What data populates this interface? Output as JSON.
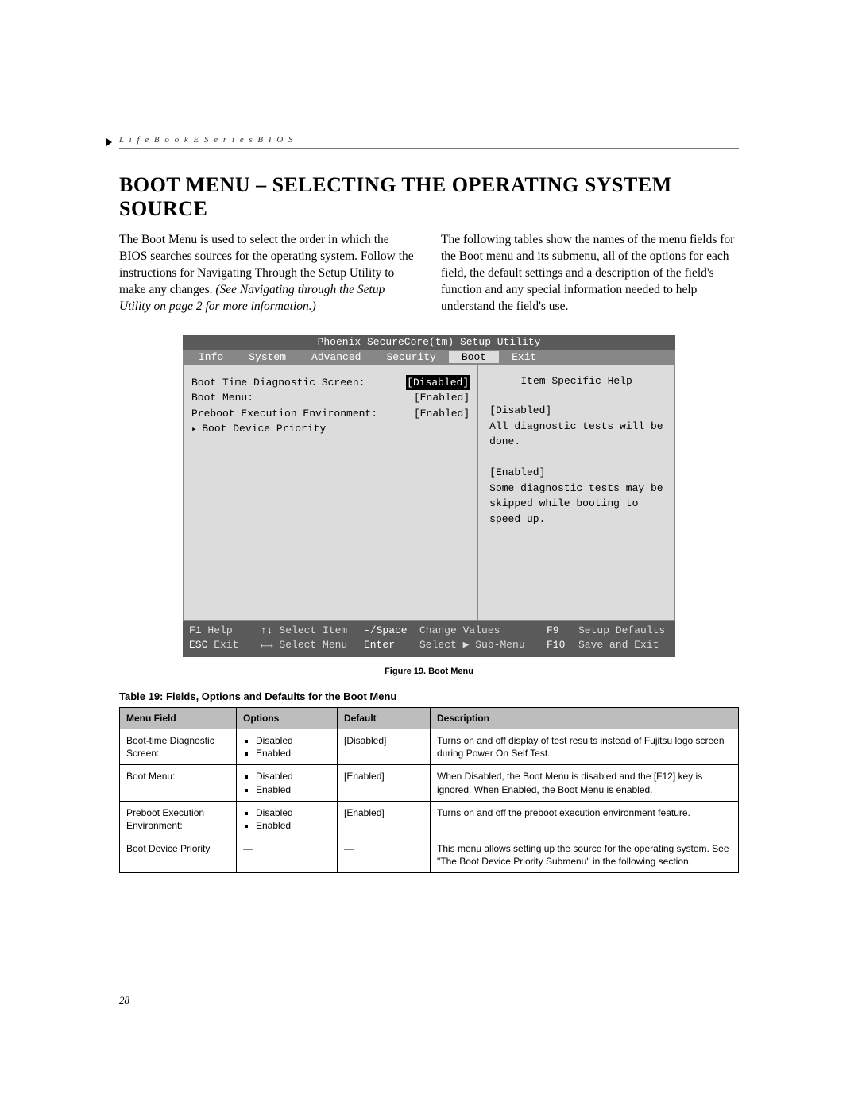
{
  "header_running": "L i f e B o o k   E   S e r i e s   B I O S",
  "title": "BOOT MENU – SELECTING THE OPERATING SYSTEM SOURCE",
  "para_left_plain": "The Boot Menu is used to select the order in which the BIOS searches sources for the operating system. Follow the instructions for Navigating Through the Setup Utility to make any changes. ",
  "para_left_italic": "(See Navigating through the Setup Utility on page 2 for more information.)",
  "para_right": "The following tables show the names of the menu fields for the Boot menu and its submenu, all of the options for each field, the default settings and a description of the field's function and any special information needed to help understand the field's use.",
  "bios": {
    "title": "Phoenix SecureCore(tm) Setup Utility",
    "tabs": [
      "Info",
      "System",
      "Advanced",
      "Security",
      "Boot",
      "Exit"
    ],
    "active_tab": "Boot",
    "items": [
      {
        "label": "Boot Time Diagnostic Screen:",
        "value": "[Disabled]",
        "selected": true
      },
      {
        "label": "Boot Menu:",
        "value": "[Enabled]",
        "selected": false
      },
      {
        "label": "Preboot Execution Environment:",
        "value": "[Enabled]",
        "selected": false
      }
    ],
    "submenu_label": "Boot Device Priority",
    "help": {
      "header": "Item Specific Help",
      "p1": "[Disabled]",
      "p2": "All diagnostic tests will be done.",
      "p3": "[Enabled]",
      "p4": "Some diagnostic tests may be skipped while booting to speed up."
    },
    "footer": {
      "r1": {
        "k1": "F1",
        "v1": "Help",
        "k2": "↑↓",
        "v2": "Select Item",
        "k3": "-/Space",
        "v3": "Change Values",
        "k4": "F9",
        "v4": "Setup Defaults"
      },
      "r2": {
        "k1": "ESC",
        "v1": "Exit",
        "k2": "←→",
        "v2": "Select Menu",
        "k3": "Enter",
        "v3": "Select ▶ Sub-Menu",
        "k4": "F10",
        "v4": "Save and Exit"
      }
    }
  },
  "figure_caption": "Figure 19.  Boot Menu",
  "table_caption": "Table 19: Fields, Options and Defaults for the Boot Menu",
  "table": {
    "headers": [
      "Menu Field",
      "Options",
      "Default",
      "Description"
    ],
    "rows": [
      {
        "field": "Boot-time Diagnostic Screen:",
        "options": [
          "Disabled",
          "Enabled"
        ],
        "default": "[Disabled]",
        "desc": "Turns on and off display of test results instead of Fujitsu logo screen during Power On Self Test."
      },
      {
        "field": "Boot Menu:",
        "options": [
          "Disabled",
          "Enabled"
        ],
        "default": "[Enabled]",
        "desc": "When Disabled, the Boot Menu is disabled and the [F12] key is ignored. When Enabled, the Boot Menu is enabled."
      },
      {
        "field": "Preboot Execution Environment:",
        "options": [
          "Disabled",
          "Enabled"
        ],
        "default": "[Enabled]",
        "desc": "Turns on and off the preboot execution environment feature."
      },
      {
        "field": "Boot Device Priority",
        "options": [],
        "options_dash": "—",
        "default": "—",
        "desc": "This menu allows setting up the source for the operating system. See \"The Boot Device Priority Submenu\" in the following section."
      }
    ]
  },
  "page_number": "28"
}
